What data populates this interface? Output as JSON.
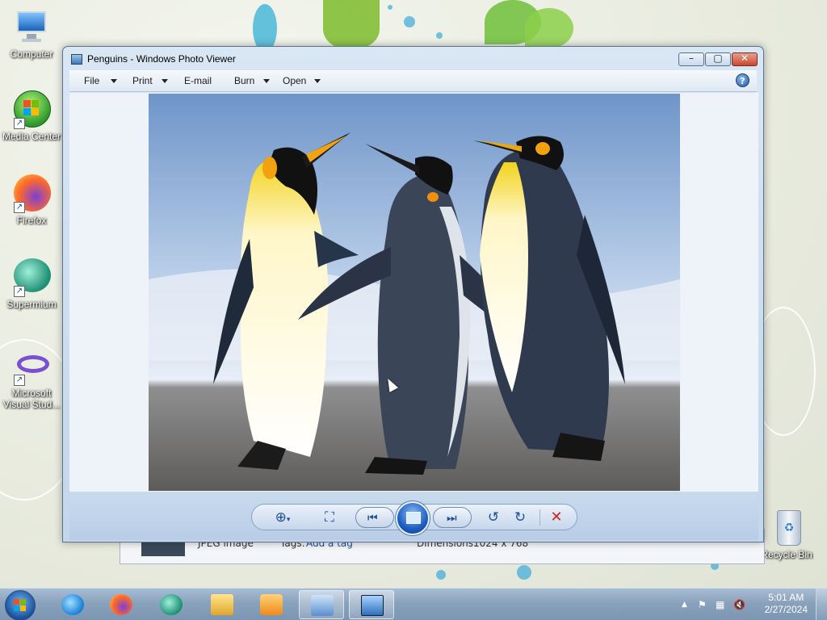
{
  "desktop": {
    "icons": [
      {
        "label": "Computer",
        "icon": "computer-icon"
      },
      {
        "label": "Media Center",
        "icon": "media-center-icon"
      },
      {
        "label": "Firefox",
        "icon": "firefox-icon"
      },
      {
        "label": "Supermium",
        "icon": "supermium-icon"
      },
      {
        "label": "Microsoft Visual Stud...",
        "icon": "visual-studio-icon"
      },
      {
        "label": "Recycle Bin",
        "icon": "recycle-bin-icon"
      }
    ]
  },
  "background_window": {
    "type_text": "JPEG image",
    "tags_label": "Tags:",
    "tags_value": "Add a tag",
    "dimensions_label": "Dimensions:",
    "dimensions_value": "1024 x 768"
  },
  "window": {
    "title": "Penguins - Windows Photo Viewer",
    "menu": {
      "file": "File",
      "print": "Print",
      "email": "E-mail",
      "burn": "Burn",
      "open": "Open"
    },
    "help": "?",
    "photo_alt": "Three penguins on a beach",
    "toolbar": {
      "zoom_icon": "zoom-icon",
      "actual_size_icon": "fit-to-window-icon",
      "previous_icon": "previous-icon",
      "slideshow_icon": "slideshow-icon",
      "next_icon": "next-icon",
      "rotate_ccw_icon": "rotate-counterclockwise-icon",
      "rotate_cw_icon": "rotate-clockwise-icon",
      "delete_icon": "delete-icon"
    }
  },
  "taskbar": {
    "pinned": [
      "internet-explorer-icon",
      "firefox-icon",
      "supermium-icon",
      "file-explorer-icon",
      "media-player-icon",
      "control-panel-icon",
      "photo-viewer-icon"
    ],
    "clock_time": "5:01 AM",
    "clock_date": "2/27/2024"
  },
  "colors": {
    "accent": "#1f5aa8",
    "delete_red": "#d0221a",
    "taskbar": "#8aa2bc"
  }
}
